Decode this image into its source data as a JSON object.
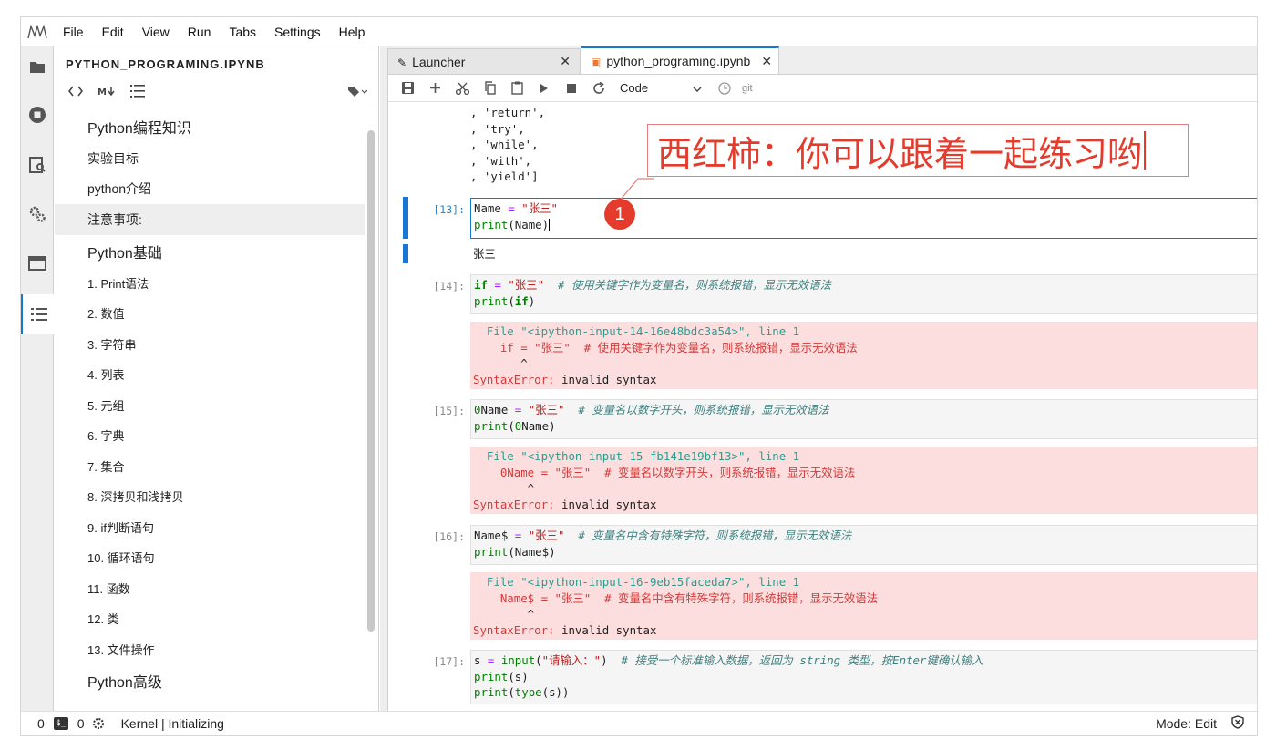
{
  "menubar": {
    "items": [
      "File",
      "Edit",
      "View",
      "Run",
      "Tabs",
      "Settings",
      "Help"
    ]
  },
  "sidebar": {
    "title": "PYTHON_PROGRAMING.IPYNB",
    "toc": [
      {
        "label": "Python编程知识",
        "level": "h1"
      },
      {
        "label": "实验目标",
        "level": "h2"
      },
      {
        "label": "python介绍",
        "level": "h2"
      },
      {
        "label": "注意事项:",
        "level": "h2",
        "selected": true
      },
      {
        "label": "Python基础",
        "level": "h1"
      },
      {
        "label": "1. Print语法",
        "level": "h3"
      },
      {
        "label": "2. 数值",
        "level": "h3"
      },
      {
        "label": "3. 字符串",
        "level": "h3"
      },
      {
        "label": "4. 列表",
        "level": "h3"
      },
      {
        "label": "5. 元组",
        "level": "h3"
      },
      {
        "label": "6. 字典",
        "level": "h3"
      },
      {
        "label": "7. 集合",
        "level": "h3"
      },
      {
        "label": "8. 深拷贝和浅拷贝",
        "level": "h3"
      },
      {
        "label": "9. if判断语句",
        "level": "h3"
      },
      {
        "label": "10. 循环语句",
        "level": "h3"
      },
      {
        "label": "11. 函数",
        "level": "h3"
      },
      {
        "label": "12. 类",
        "level": "h3"
      },
      {
        "label": "13. 文件操作",
        "level": "h3"
      },
      {
        "label": "Python高级",
        "level": "h1"
      }
    ]
  },
  "tabs": [
    {
      "label": "Launcher",
      "close": "✕"
    },
    {
      "label": "python_programing.ipynb",
      "close": "✕"
    }
  ],
  "toolbar": {
    "cell_type": "Code",
    "git": "git"
  },
  "cells": {
    "top_output": ", 'return',\n, 'try',\n, 'while',\n, 'with',\n, 'yield']",
    "c13": {
      "prompt": "[13]:",
      "out": "张三"
    },
    "c14": {
      "prompt": "[14]:",
      "comment": "# 使用关键字作为变量名，则系统报错，显示无效语法",
      "err_file": "<ipython-input-14-16e48bdc3a54>",
      "err_comment": "# 使用关键字作为变量名，则系统报错，显示无效语法"
    },
    "c15": {
      "prompt": "[15]:",
      "comment": "# 变量名以数字开头，则系统报错，显示无效语法",
      "err_file": "<ipython-input-15-fb141e19bf13>",
      "err_comment": "# 变量名以数字开头，则系统报错，显示无效语法"
    },
    "c16": {
      "prompt": "[16]:",
      "comment": "# 变量名中含有特殊字符，则系统报错，显示无效语法",
      "err_file": "<ipython-input-16-9eb15faceda7>",
      "err_comment": "# 变量名中含有特殊字符，则系统报错，显示无效语法"
    },
    "c17": {
      "prompt": "[17]:",
      "comment": "# 接受一个标准输入数据，返回为 string 类型，按Enter键确认输入"
    },
    "error_name": "SyntaxError:",
    "error_msg": " invalid syntax"
  },
  "annotation": {
    "text": "西红柿：你可以跟着一起练习哟",
    "badge": "1",
    "color": "#e43b2c"
  },
  "status": {
    "left_count1": "0",
    "left_count2": "0",
    "kernel": "Kernel | Initializing",
    "mode": "Mode: Edit"
  },
  "colors": {
    "accent": "#1976d2",
    "error_bg": "#fddede"
  }
}
